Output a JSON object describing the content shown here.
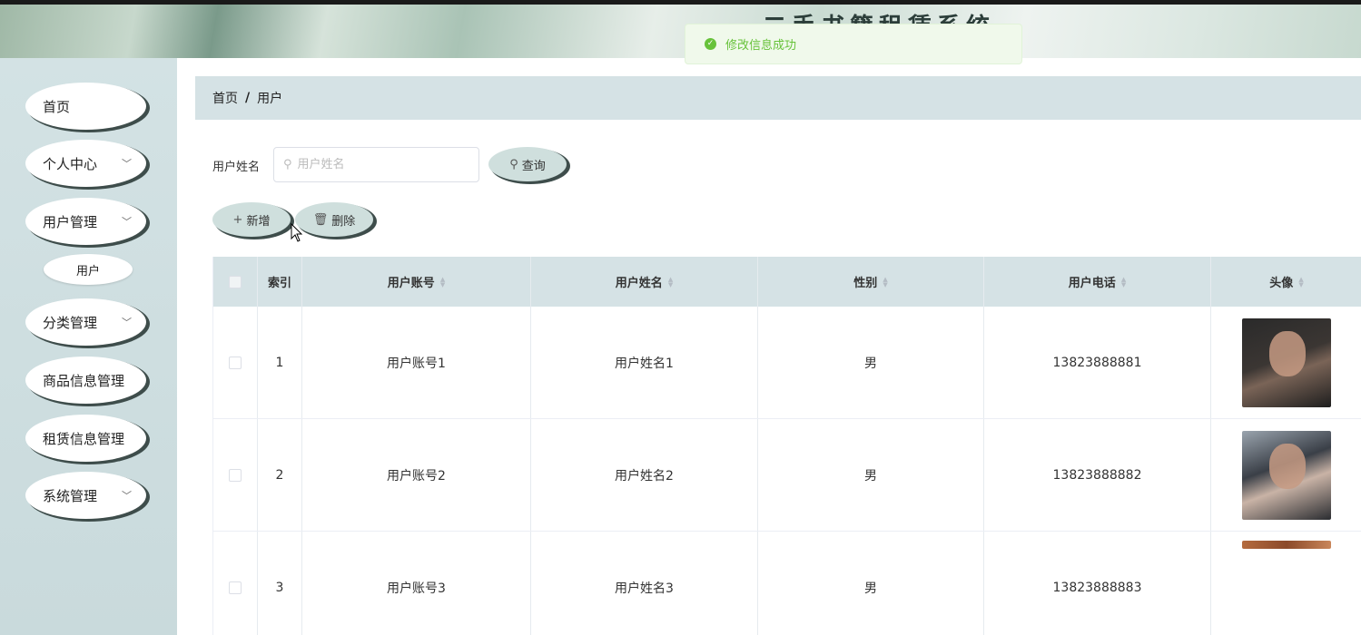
{
  "header": {
    "title": "二手书籍租赁系统",
    "toast": "修改信息成功",
    "toast_icon": "check-circle-icon"
  },
  "sidebar": {
    "items": [
      {
        "label": "首页",
        "has_chevron": false
      },
      {
        "label": "个人中心",
        "has_chevron": true
      },
      {
        "label": "用户管理",
        "has_chevron": true
      },
      {
        "label": "分类管理",
        "has_chevron": true
      },
      {
        "label": "商品信息管理",
        "has_chevron": false
      },
      {
        "label": "租赁信息管理",
        "has_chevron": false
      },
      {
        "label": "系统管理",
        "has_chevron": true
      }
    ],
    "subitems": [
      {
        "label": "用户"
      }
    ]
  },
  "breadcrumb": {
    "home": "首页",
    "separator": "/",
    "current": "用户"
  },
  "search": {
    "label": "用户姓名",
    "placeholder": "用户姓名",
    "value": "",
    "button": "查询"
  },
  "actions": {
    "add": "新增",
    "delete": "删除"
  },
  "table": {
    "headers": [
      "索引",
      "用户账号",
      "用户姓名",
      "性别",
      "用户电话",
      "头像"
    ],
    "rows": [
      {
        "index": "1",
        "account": "用户账号1",
        "name": "用户姓名1",
        "gender": "男",
        "phone": "13823888881"
      },
      {
        "index": "2",
        "account": "用户账号2",
        "name": "用户姓名2",
        "gender": "男",
        "phone": "13823888882"
      },
      {
        "index": "3",
        "account": "用户账号3",
        "name": "用户姓名3",
        "gender": "男",
        "phone": "13823888883"
      }
    ]
  },
  "colors": {
    "accent": "#d5e2e5",
    "success": "#67c23a",
    "menu_shadow": "#3e4d4b"
  }
}
